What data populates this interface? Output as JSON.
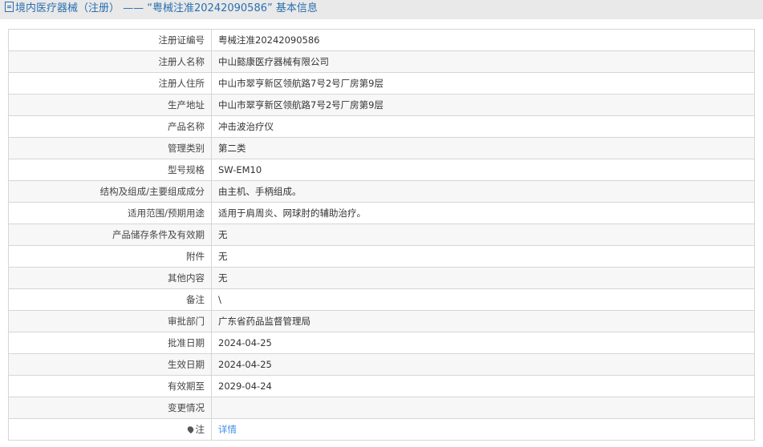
{
  "title": "境内医疗器械（注册） ——  “粤械注准20242090586”  基本信息",
  "rows": [
    {
      "k": "注册证编号",
      "v": "粤械注准20242090586"
    },
    {
      "k": "注册人名称",
      "v": "中山懿康医疗器械有限公司"
    },
    {
      "k": "注册人住所",
      "v": "中山市翠亨新区领航路7号2号厂房第9层"
    },
    {
      "k": "生产地址",
      "v": "中山市翠亨新区领航路7号2号厂房第9层"
    },
    {
      "k": "产品名称",
      "v": "冲击波治疗仪"
    },
    {
      "k": "管理类别",
      "v": "第二类"
    },
    {
      "k": "型号规格",
      "v": "SW-EM10"
    },
    {
      "k": "结构及组成/主要组成成分",
      "v": "由主机、手柄组成。"
    },
    {
      "k": "适用范围/预期用途",
      "v": "适用于肩周炎、网球肘的辅助治疗。"
    },
    {
      "k": "产品储存条件及有效期",
      "v": "无"
    },
    {
      "k": "附件",
      "v": "无"
    },
    {
      "k": "其他内容",
      "v": "无"
    },
    {
      "k": "备注",
      "v": "\\"
    },
    {
      "k": "审批部门",
      "v": "广东省药品监督管理局"
    },
    {
      "k": "批准日期",
      "v": "2024-04-25"
    },
    {
      "k": "生效日期",
      "v": "2024-04-25"
    },
    {
      "k": "有效期至",
      "v": "2029-04-24"
    },
    {
      "k": "变更情况",
      "v": ""
    }
  ],
  "note": {
    "label": "注",
    "link": "详情"
  }
}
